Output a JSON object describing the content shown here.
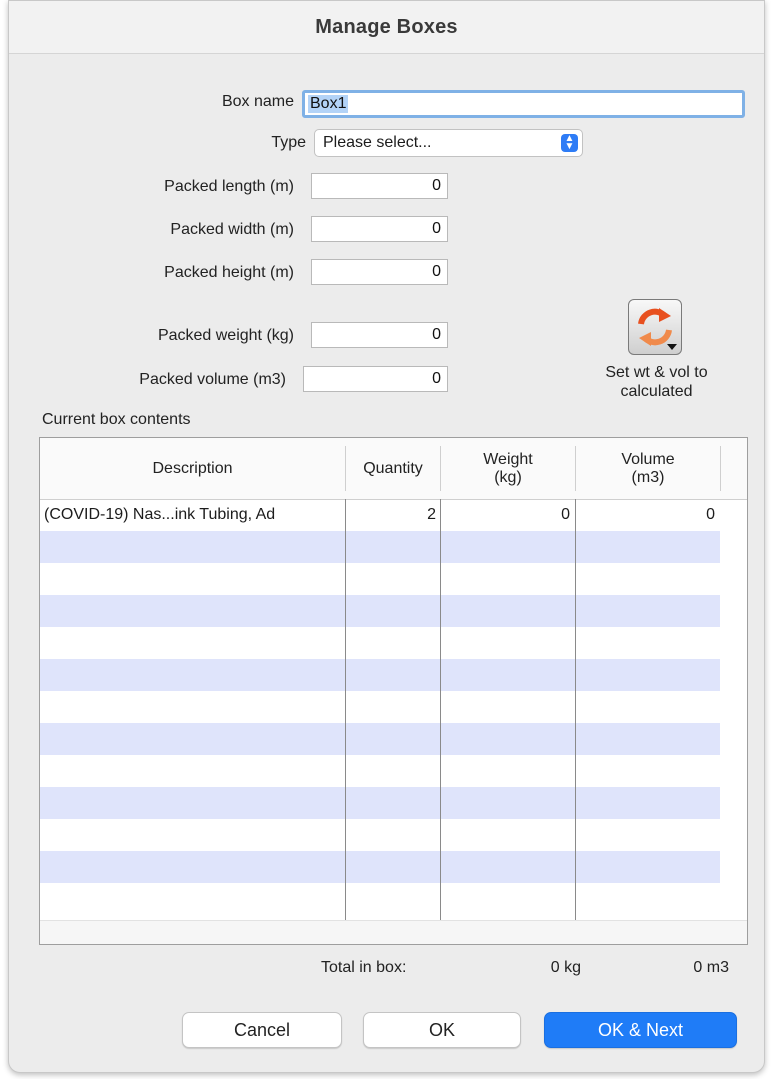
{
  "dialog": {
    "title": "Manage Boxes"
  },
  "form": {
    "box_name_label": "Box name",
    "box_name_value": "Box1",
    "type_label": "Type",
    "type_value": "Please select...",
    "packed_length_label": "Packed length (m)",
    "packed_length_value": "0",
    "packed_width_label": "Packed width (m)",
    "packed_width_value": "0",
    "packed_height_label": "Packed height (m)",
    "packed_height_value": "0",
    "packed_weight_label": "Packed weight (kg)",
    "packed_weight_value": "0",
    "packed_volume_label": "Packed volume (m3)",
    "packed_volume_value": "0",
    "calc_button_caption": "Set wt & vol to calculated"
  },
  "contents": {
    "section_label": "Current box contents",
    "columns": [
      "Description",
      "Quantity",
      "Weight (kg)",
      "Volume (m3)"
    ],
    "rows": [
      {
        "description": "(COVID-19) Nas...ink Tubing, Ad",
        "quantity": "2",
        "weight": "0",
        "volume": "0"
      }
    ]
  },
  "totals": {
    "label": "Total in box:",
    "weight": "0 kg",
    "volume": "0  m3"
  },
  "buttons": {
    "cancel": "Cancel",
    "ok": "OK",
    "ok_next": "OK & Next"
  }
}
